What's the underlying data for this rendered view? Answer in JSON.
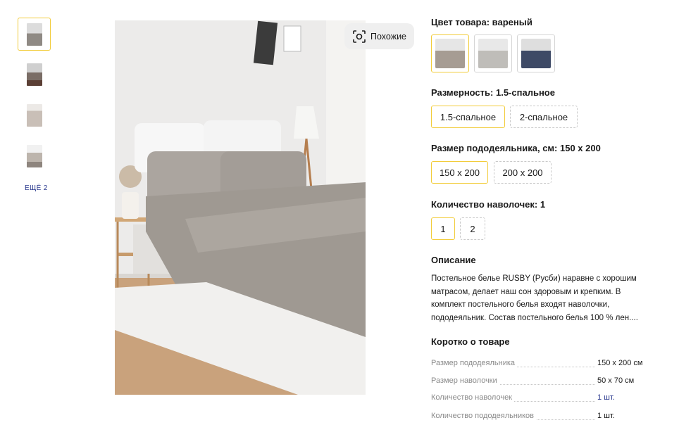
{
  "gallery": {
    "more_label": "ЕЩЁ 2",
    "similar_label": "Похожие"
  },
  "product": {
    "color_label": "Цвет товара:",
    "color_value": "вареный",
    "size_label": "Размерность:",
    "size_value": "1.5-спальное",
    "size_options": [
      "1.5-спальное",
      "2-спальное"
    ],
    "duvet_label": "Размер пододеяльника, см:",
    "duvet_value": "150 x 200",
    "duvet_options": [
      "150 x 200",
      "200 x 200"
    ],
    "pillow_label": "Количество наволочек:",
    "pillow_value": "1",
    "pillow_options": [
      "1",
      "2"
    ],
    "description_title": "Описание",
    "description_text": "Постельное белье RUSBY (Русби) наравне с хорошим матрасом, делает наш сон здоровым и крепким. В комплект постельного белья входят наволочки, пододеяльник. Состав постельного белья 100 % лен....",
    "brief_title": "Коротко о товаре",
    "specs": [
      {
        "key": "Размер пододеяльника",
        "value": "150 x 200 см"
      },
      {
        "key": "Размер наволочки",
        "value": "50 x 70 см"
      },
      {
        "key": "Количество наволочек",
        "value": "1 шт."
      },
      {
        "key": "Количество пододеяльников",
        "value": "1 шт."
      }
    ]
  },
  "colors": {
    "accent": "#f2cc3a",
    "link": "#2b3a8f"
  }
}
